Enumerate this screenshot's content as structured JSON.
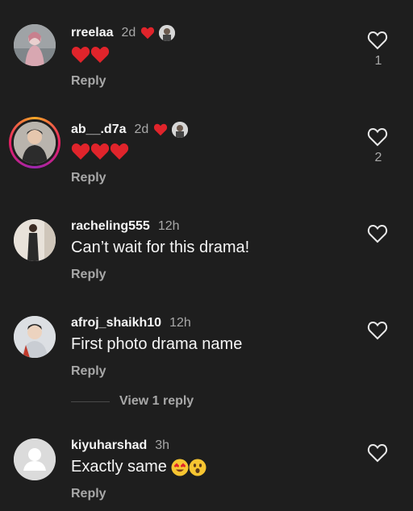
{
  "comments": [
    {
      "username": "rreelaa",
      "time": "2d",
      "text": "",
      "reply": "Reply",
      "likes": "1",
      "author_liked": true,
      "story": false,
      "emoji": [
        "heart",
        "heart"
      ]
    },
    {
      "username": "ab__.d7a",
      "time": "2d",
      "text": "",
      "reply": "Reply",
      "likes": "2",
      "author_liked": true,
      "story": true,
      "emoji": [
        "heart",
        "heart",
        "heart"
      ]
    },
    {
      "username": "racheling555",
      "time": "12h",
      "text": "Can’t wait for this drama!",
      "reply": "Reply",
      "likes": "",
      "author_liked": false,
      "story": false
    },
    {
      "username": "afroj_shaikh10",
      "time": "12h",
      "text": "First photo drama name",
      "reply": "Reply",
      "likes": "",
      "author_liked": false,
      "story": false
    },
    {
      "username": "kiyuharshad",
      "time": "3h",
      "text": "Exactly same ",
      "reply": "Reply",
      "likes": "",
      "author_liked": false,
      "story": false,
      "emoji": [
        "heart-eyes",
        "astonished"
      ]
    }
  ],
  "view_replies_label": "View 1 reply",
  "colors": {
    "background": "#1e1e1e",
    "heart_red": "#e0242b",
    "secondary_text": "#a8a8a8"
  },
  "icons": {
    "like": "heart-outline-icon",
    "author_like": "red-heart-icon"
  }
}
